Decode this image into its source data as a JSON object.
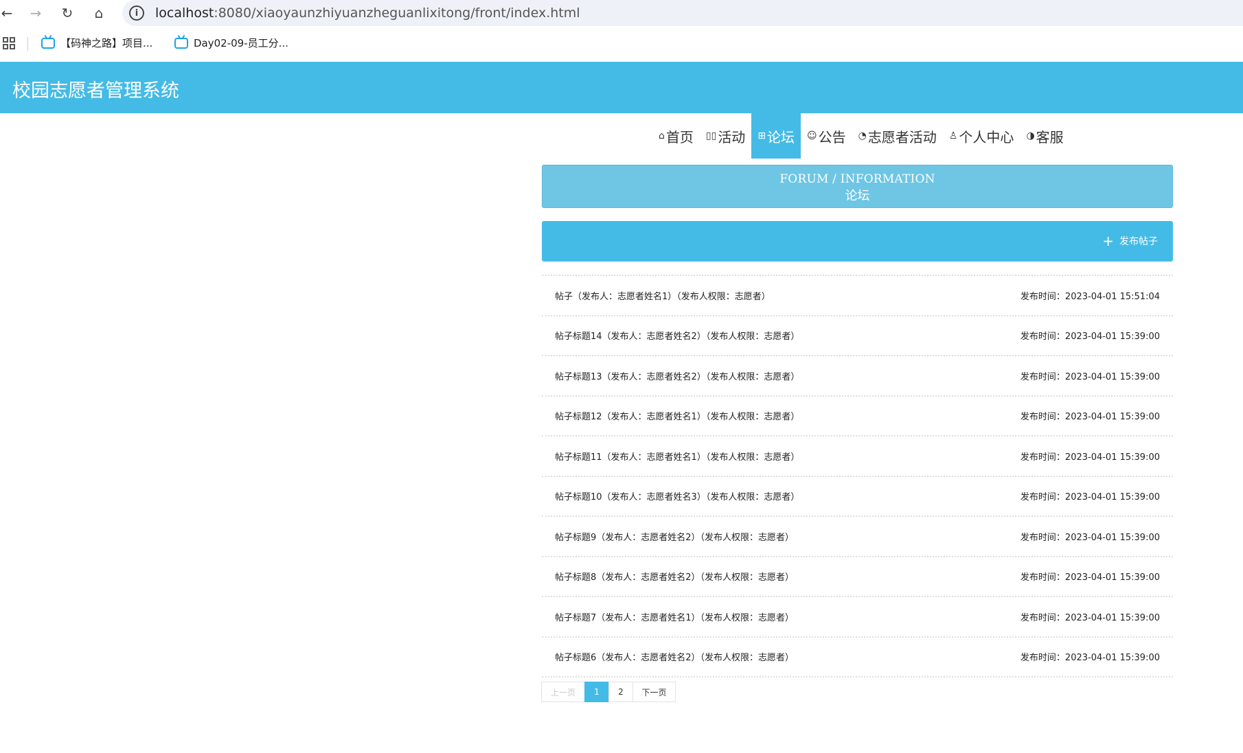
{
  "browser": {
    "back_icon": "←",
    "forward_icon": "→",
    "reload_icon": "↻",
    "home_icon": "⌂",
    "url_host": "localhost",
    "url_path": ":8080/xiaoyaunzhiyuanzheguanlixitong/front/index.html",
    "info_icon": "i",
    "bookmarks": [
      {
        "label": "【码神之路】项目..."
      },
      {
        "label": "Day02-09-员工分..."
      }
    ]
  },
  "site": {
    "title": "校园志愿者管理系统"
  },
  "nav": {
    "items": [
      {
        "icon": "⌂",
        "label": "首页"
      },
      {
        "icon": "▯▯",
        "label": "活动"
      },
      {
        "icon": "⊞",
        "label": "论坛"
      },
      {
        "icon": "☺",
        "label": "公告"
      },
      {
        "icon": "◔",
        "label": "志愿者活动"
      },
      {
        "icon": "♙",
        "label": "个人中心"
      },
      {
        "icon": "◑",
        "label": "客服"
      }
    ],
    "active": "论坛"
  },
  "banner": {
    "en": "FORUM / INFORMATION",
    "cn": "论坛"
  },
  "actions": {
    "publish_label": "发布帖子",
    "publish_icon": "+"
  },
  "posts": [
    {
      "title": "帖子（发布人：志愿者姓名1）（发布人权限：志愿者）",
      "time": "发布时间：2023-04-01 15:51:04"
    },
    {
      "title": "帖子标题14（发布人：志愿者姓名2）（发布人权限：志愿者）",
      "time": "发布时间：2023-04-01 15:39:00"
    },
    {
      "title": "帖子标题13（发布人：志愿者姓名2）（发布人权限：志愿者）",
      "time": "发布时间：2023-04-01 15:39:00"
    },
    {
      "title": "帖子标题12（发布人：志愿者姓名1）（发布人权限：志愿者）",
      "time": "发布时间：2023-04-01 15:39:00"
    },
    {
      "title": "帖子标题11（发布人：志愿者姓名1）（发布人权限：志愿者）",
      "time": "发布时间：2023-04-01 15:39:00"
    },
    {
      "title": "帖子标题10（发布人：志愿者姓名3）（发布人权限：志愿者）",
      "time": "发布时间：2023-04-01 15:39:00"
    },
    {
      "title": "帖子标题9（发布人：志愿者姓名2）（发布人权限：志愿者）",
      "time": "发布时间：2023-04-01 15:39:00"
    },
    {
      "title": "帖子标题8（发布人：志愿者姓名2）（发布人权限：志愿者）",
      "time": "发布时间：2023-04-01 15:39:00"
    },
    {
      "title": "帖子标题7（发布人：志愿者姓名1）（发布人权限：志愿者）",
      "time": "发布时间：2023-04-01 15:39:00"
    },
    {
      "title": "帖子标题6（发布人：志愿者姓名2）（发布人权限：志愿者）",
      "time": "发布时间：2023-04-01 15:39:00"
    }
  ],
  "pagination": {
    "prev_label": "上一页",
    "pages": [
      "1",
      "2"
    ],
    "current": "1",
    "next_label": "下一页"
  },
  "colors": {
    "primary": "#44bbe6",
    "banner": "#6ec6e4"
  }
}
